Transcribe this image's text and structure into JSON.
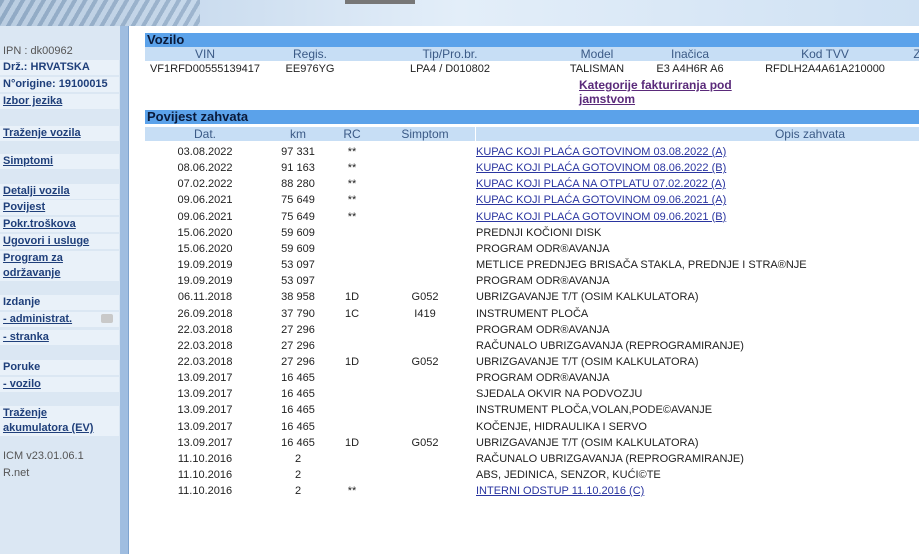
{
  "sidebar": {
    "ipn": "IPN : dk00962",
    "country": "Drž.: HRVATSKA",
    "origin": "N°origine: 19100015",
    "language": "Izbor jezika",
    "vehicle_search": "Traženje vozila",
    "symptoms": "Simptomi",
    "vehicle_details": "Detalji vozila",
    "history": "Povijest",
    "cost_coverage": "Pokr.troškova",
    "contracts": "Ugovori i usluge",
    "maintenance_1": "Program za",
    "maintenance_2": "održavanje",
    "edition": "Izdanje",
    "admin": "- administrat.",
    "customer": "- stranka",
    "messages": "Poruke",
    "vehicle_msg": "- vozilo",
    "battery_1": "Traženje",
    "battery_2": "akumulatora (EV)",
    "version": "ICM v23.01.06.1",
    "rnet": "R.net"
  },
  "vehicle": {
    "title": "Vozilo",
    "headers": {
      "vin": "VIN",
      "regis": "Regis.",
      "tip": "Tip/Pro.br.",
      "model": "Model",
      "inacica": "Inačica",
      "tvv": "Kod TVV",
      "z": "Z"
    },
    "values": {
      "vin": "VF1RFD00555139417",
      "regis": "EE976YG",
      "tip": "LPA4 / D010802",
      "model": "TALISMAN",
      "inacica": "E3 A4H6R A6",
      "tvv": "RFDLH2A4A61A210000"
    },
    "warranty_link": "Kategorije fakturiranja pod jamstvom"
  },
  "history": {
    "title": "Povijest zahvata",
    "headers": {
      "date": "Dat.",
      "km": "km",
      "rc": "RC",
      "symptom": "Simptom",
      "desc": "Opis zahvata"
    },
    "rows": [
      {
        "date": "03.08.2022",
        "km": "97 331",
        "rc": "**",
        "symptom": "",
        "desc": "KUPAC KOJI PLAĆA GOTOVINOM 03.08.2022 (A)",
        "link": true
      },
      {
        "date": "08.06.2022",
        "km": "91 163",
        "rc": "**",
        "symptom": "",
        "desc": "KUPAC KOJI PLAĆA GOTOVINOM 08.06.2022 (B)",
        "link": true
      },
      {
        "date": "07.02.2022",
        "km": "88 280",
        "rc": "**",
        "symptom": "",
        "desc": "KUPAC KOJI PLAĆA NA OTPLATU 07.02.2022 (A)",
        "link": true
      },
      {
        "date": "09.06.2021",
        "km": "75 649",
        "rc": "**",
        "symptom": "",
        "desc": "KUPAC KOJI PLAĆA GOTOVINOM 09.06.2021 (A)",
        "link": true
      },
      {
        "date": "09.06.2021",
        "km": "75 649",
        "rc": "**",
        "symptom": "",
        "desc": "KUPAC KOJI PLAĆA GOTOVINOM 09.06.2021 (B)",
        "link": true
      },
      {
        "date": "15.06.2020",
        "km": "59 609",
        "rc": "",
        "symptom": "",
        "desc": "PREDNJI KOČIONI DISK",
        "link": false
      },
      {
        "date": "15.06.2020",
        "km": "59 609",
        "rc": "",
        "symptom": "",
        "desc": "PROGRAM ODR®AVANJA",
        "link": false
      },
      {
        "date": "19.09.2019",
        "km": "53 097",
        "rc": "",
        "symptom": "",
        "desc": "METLICE PREDNJEG BRISAČA STAKLA, PREDNJE I STRA®NJE",
        "link": false
      },
      {
        "date": "19.09.2019",
        "km": "53 097",
        "rc": "",
        "symptom": "",
        "desc": "PROGRAM ODR®AVANJA",
        "link": false
      },
      {
        "date": "06.11.2018",
        "km": "38 958",
        "rc": "1D",
        "symptom": "G052",
        "desc": "UBRIZGAVANJE T/T (OSIM KALKULATORA)",
        "link": false
      },
      {
        "date": "26.09.2018",
        "km": "37 790",
        "rc": "1C",
        "symptom": "I419",
        "desc": "INSTRUMENT PLOČA",
        "link": false
      },
      {
        "date": "22.03.2018",
        "km": "27 296",
        "rc": "",
        "symptom": "",
        "desc": "PROGRAM ODR®AVANJA",
        "link": false
      },
      {
        "date": "22.03.2018",
        "km": "27 296",
        "rc": "",
        "symptom": "",
        "desc": "RAČUNALO UBRIZGAVANJA (REPROGRAMIRANJE)",
        "link": false
      },
      {
        "date": "22.03.2018",
        "km": "27 296",
        "rc": "1D",
        "symptom": "G052",
        "desc": "UBRIZGAVANJE T/T (OSIM KALKULATORA)",
        "link": false
      },
      {
        "date": "13.09.2017",
        "km": "16 465",
        "rc": "",
        "symptom": "",
        "desc": "PROGRAM ODR®AVANJA",
        "link": false
      },
      {
        "date": "13.09.2017",
        "km": "16 465",
        "rc": "",
        "symptom": "",
        "desc": "SJEDALA OKVIR NA PODVOZJU",
        "link": false
      },
      {
        "date": "13.09.2017",
        "km": "16 465",
        "rc": "",
        "symptom": "",
        "desc": "INSTRUMENT PLOČA,VOLAN,PODE©AVANJE",
        "link": false
      },
      {
        "date": "13.09.2017",
        "km": "16 465",
        "rc": "",
        "symptom": "",
        "desc": "KOČENJE, HIDRAULIKA I SERVO",
        "link": false
      },
      {
        "date": "13.09.2017",
        "km": "16 465",
        "rc": "1D",
        "symptom": "G052",
        "desc": "UBRIZGAVANJE T/T (OSIM KALKULATORA)",
        "link": false
      },
      {
        "date": "11.10.2016",
        "km": "2",
        "rc": "",
        "symptom": "",
        "desc": "RAČUNALO UBRIZGAVANJA (REPROGRAMIRANJE)",
        "link": false
      },
      {
        "date": "11.10.2016",
        "km": "2",
        "rc": "",
        "symptom": "",
        "desc": "ABS, JEDINICA, SENZOR, KUĆI©TE",
        "link": false
      },
      {
        "date": "11.10.2016",
        "km": "2",
        "rc": "**",
        "symptom": "",
        "desc": "INTERNI ODSTUP 11.10.2016 (C)",
        "link": true
      }
    ]
  }
}
